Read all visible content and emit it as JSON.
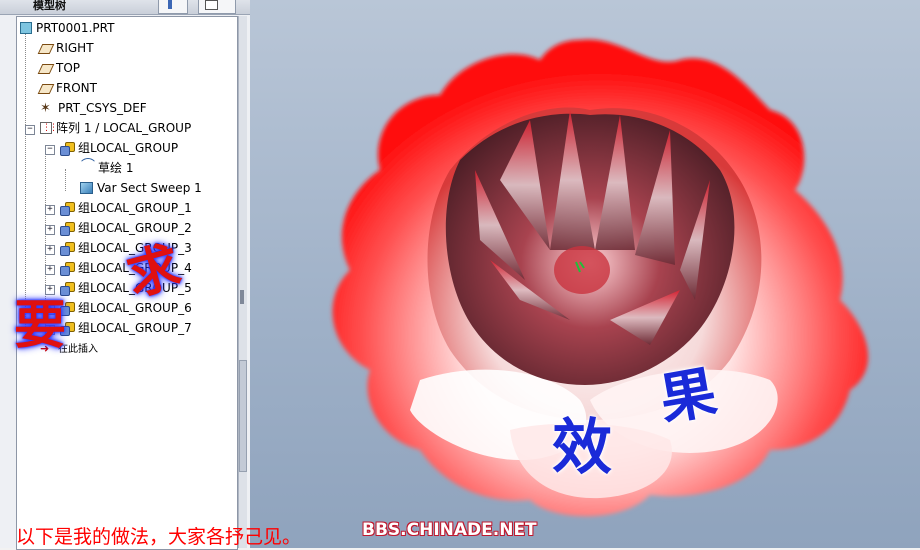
{
  "panel": {
    "title": "模型树"
  },
  "tree": [
    {
      "label": "PRT0001.PRT",
      "icon": "part-icon"
    },
    {
      "label": "RIGHT",
      "icon": "datum-plane-icon"
    },
    {
      "label": "TOP",
      "icon": "datum-plane-icon"
    },
    {
      "label": "FRONT",
      "icon": "datum-plane-icon"
    },
    {
      "label": "PRT_CSYS_DEF",
      "icon": "csys-icon"
    },
    {
      "label": "阵列 1 / LOCAL_GROUP",
      "icon": "pattern-icon",
      "expander": "−"
    },
    {
      "label": "组LOCAL_GROUP",
      "icon": "group-icon",
      "expander": "−"
    },
    {
      "label": "草绘 1",
      "icon": "sketch-icon"
    },
    {
      "label": "Var Sect Sweep 1",
      "icon": "sweep-icon"
    },
    {
      "label": "组LOCAL_GROUP_1",
      "icon": "group-icon",
      "expander": "+"
    },
    {
      "label": "组LOCAL_GROUP_2",
      "icon": "group-icon",
      "expander": "+"
    },
    {
      "label": "组LOCAL_GROUP_3",
      "icon": "group-icon",
      "expander": "+"
    },
    {
      "label": "组LOCAL_GROUP_4",
      "icon": "group-icon",
      "expander": "+"
    },
    {
      "label": "组LOCAL_GROUP_5",
      "icon": "group-icon",
      "expander": "+"
    },
    {
      "label": "组LOCAL_GROUP_6",
      "icon": "group-icon",
      "expander": "+"
    },
    {
      "label": "组LOCAL_GROUP_7",
      "icon": "group-icon",
      "expander": "+"
    },
    {
      "label": "在此插入",
      "icon": "insert-here-icon"
    }
  ],
  "overlay": {
    "yao": "要",
    "qiu": "求",
    "xiao": "效",
    "guo": "果",
    "caption": "以下是我的做法，大家各抒己见。",
    "watermark": "BBS.CHINADE.NET"
  },
  "colors": {
    "petal_outer": "#ff1a1a",
    "petal_inner": "#ffffff",
    "core": "#7a1f2a",
    "viewport_bg": "#a9b8cc"
  }
}
